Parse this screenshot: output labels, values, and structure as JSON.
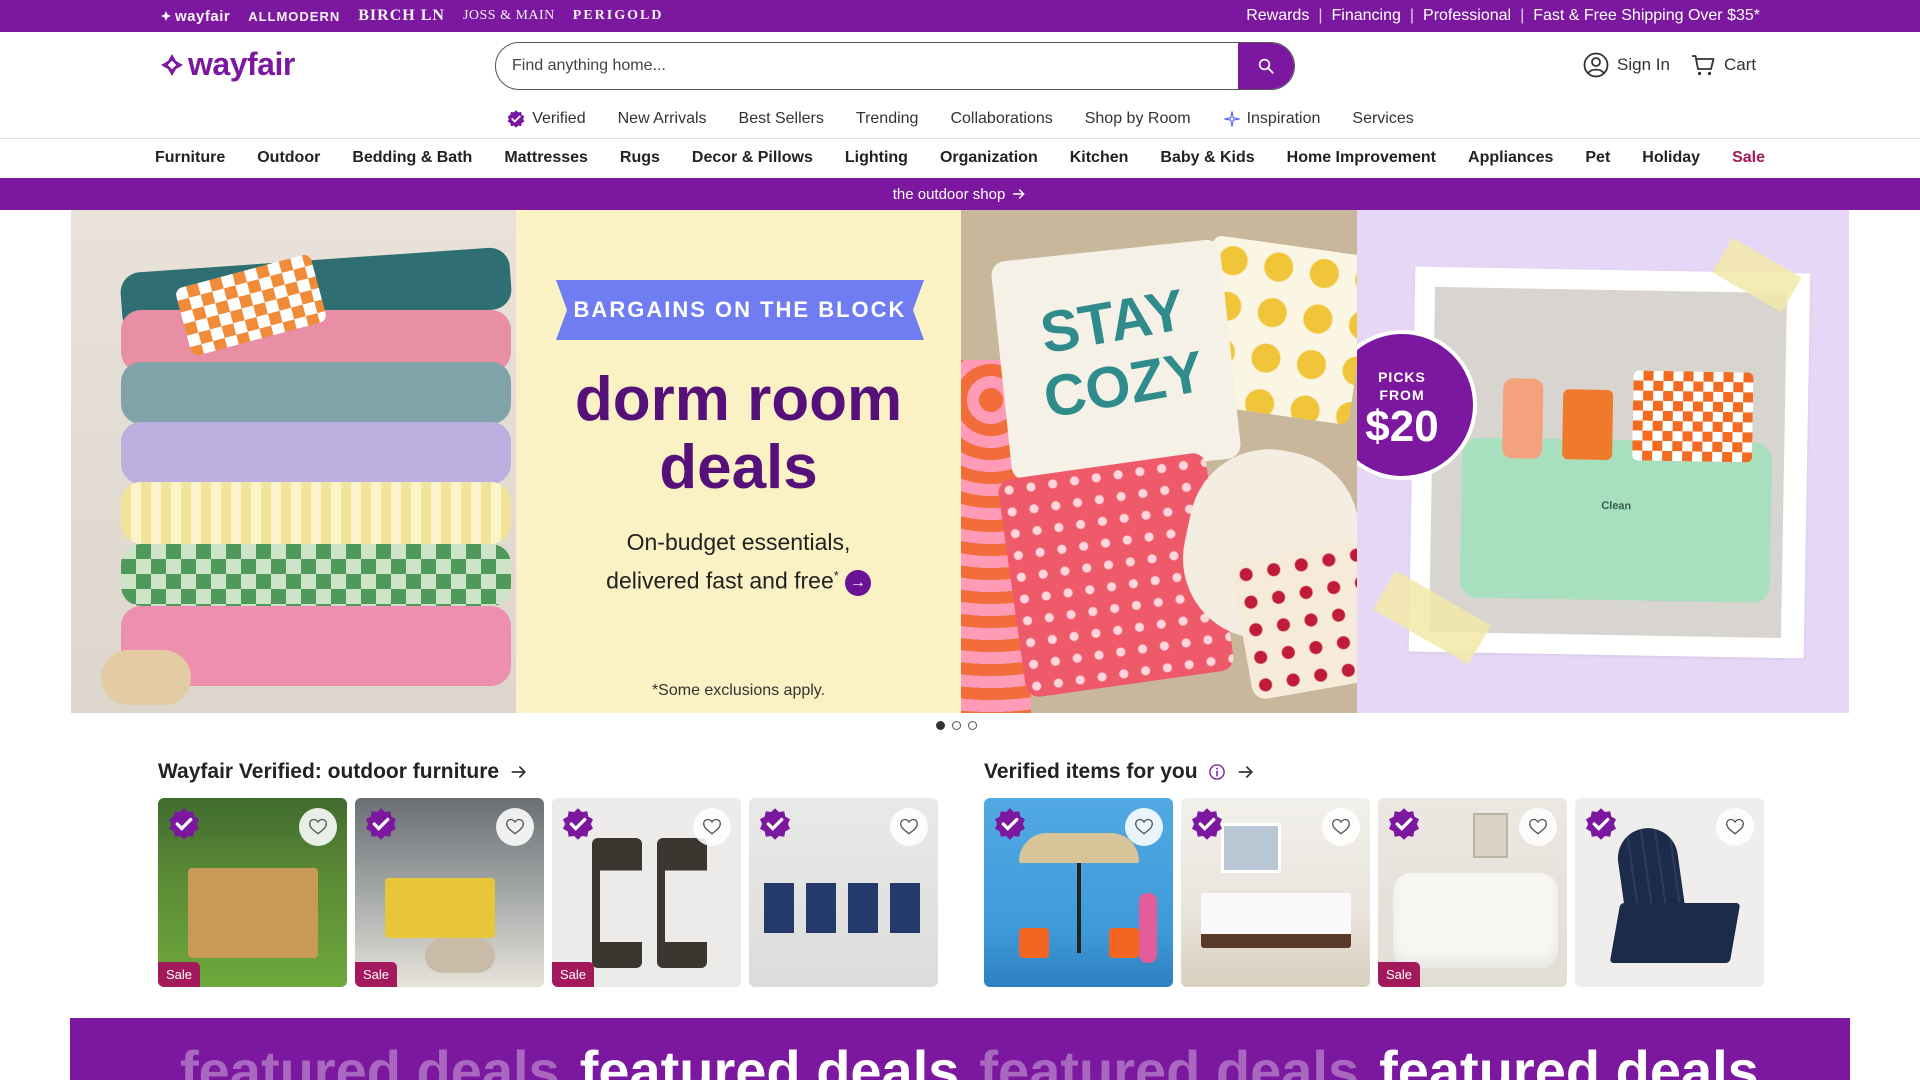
{
  "brands": {
    "wayfair": "wayfair",
    "allmodern": "ALLMODERN",
    "birch": "BIRCH LN",
    "joss": "JOSS & MAIN",
    "perigold": "PERIGOLD"
  },
  "toplinks": [
    "Rewards",
    "Financing",
    "Professional",
    "Fast & Free Shipping Over $35*"
  ],
  "header": {
    "logo": "wayfair",
    "search_placeholder": "Find anything home...",
    "sign_in": "Sign In",
    "cart": "Cart"
  },
  "subnav": [
    "Verified",
    "New Arrivals",
    "Best Sellers",
    "Trending",
    "Collaborations",
    "Shop by Room",
    "Inspiration",
    "Services"
  ],
  "categories": [
    "Furniture",
    "Outdoor",
    "Bedding & Bath",
    "Mattresses",
    "Rugs",
    "Decor & Pillows",
    "Lighting",
    "Organization",
    "Kitchen",
    "Baby & Kids",
    "Home Improvement",
    "Appliances",
    "Pet",
    "Holiday",
    "Sale"
  ],
  "promo": {
    "text": "the outdoor shop"
  },
  "hero": {
    "ribbon": "BARGAINS ON THE BLOCK",
    "title_line1": "dorm room",
    "title_line2": "deals",
    "sub_line1": "On-budget essentials,",
    "sub_line2": "delivered fast and free",
    "sub_asterisk": "*",
    "footnote": "*Some exclusions apply.",
    "picks_small_1": "PICKS",
    "picks_small_2": "FROM",
    "picks_price": "$20",
    "pillow_text": "STAY COZY",
    "basket_text": "Clean"
  },
  "carousel": {
    "current": 1,
    "total": 3
  },
  "sections": {
    "left_title": "Wayfair Verified: outdoor furniture",
    "right_title": "Verified items for you"
  },
  "sale_label": "Sale",
  "featured": {
    "text": "featured deals"
  },
  "colors": {
    "brand_purple": "#7b189f",
    "sale_red": "#a3195b",
    "ribbon_blue": "#6f7cf2"
  }
}
